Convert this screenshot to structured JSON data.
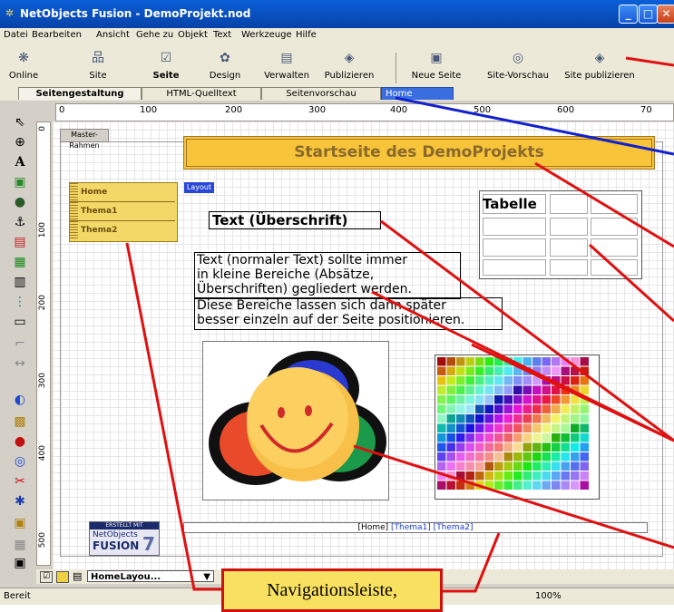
{
  "window": {
    "title": "NetObjects Fusion - DemoProjekt.nod",
    "app_icon": "netobjects-star-icon",
    "controls": [
      "minimize-icon",
      "maximize-icon",
      "close-icon"
    ]
  },
  "menu": [
    "Datei",
    "Bearbeiten",
    "Ansicht",
    "Gehe zu",
    "Objekt",
    "Text",
    "Werkzeuge",
    "Hilfe"
  ],
  "toolbar": [
    {
      "label": "Online",
      "icon": "online-icon"
    },
    {
      "label": "Site",
      "icon": "site-icon"
    },
    {
      "label": "Seite",
      "icon": "page-icon",
      "active": true
    },
    {
      "label": "Design",
      "icon": "design-icon"
    },
    {
      "label": "Verwalten",
      "icon": "manage-icon"
    },
    {
      "label": "Publizieren",
      "icon": "publish-icon"
    },
    {
      "label": "Neue Seite",
      "icon": "new-page-icon"
    },
    {
      "label": "Site-Vorschau",
      "icon": "site-preview-icon"
    },
    {
      "label": "Site publizieren",
      "icon": "site-publish-icon"
    }
  ],
  "tabs": [
    "Seitengestaltung",
    "HTML-Quelltext",
    "Seitenvorschau"
  ],
  "active_tab": "Seitengestaltung",
  "page_name": "Home",
  "ruler": {
    "h_labels": [
      "0",
      "100",
      "200",
      "300",
      "400",
      "500",
      "600",
      "70"
    ],
    "v_labels": [
      "0",
      "100",
      "200",
      "300",
      "400",
      "500"
    ]
  },
  "page": {
    "master_frame_label": "Master-Rahmen",
    "layout_label": "Layout",
    "banner_text": "Startseite des DemoProjekts",
    "nav_items": [
      "Home",
      "Thema1",
      "Thema2"
    ],
    "heading_text": "Text (Überschrift)",
    "body_lines_1": [
      "Text (normaler Text) sollte immer",
      "in kleine Bereiche (Absätze,",
      "Überschriften) gegliedert werden."
    ],
    "body_lines_2": [
      "Diese Bereiche lassen sich dann später",
      "besser einzeln auf der Seite positionieren."
    ],
    "table_header": "Tabelle",
    "footer_links": [
      "Home",
      "Thema1",
      "Thema2"
    ],
    "badge": {
      "line1": "ERSTELLT MIT",
      "line2": "NetObjects",
      "line3": "FUSION",
      "line4": "7"
    }
  },
  "bottom_toolbar": {
    "layout_select": "HomeLayou..."
  },
  "status": {
    "left": "Bereit",
    "zoom": "100%"
  },
  "callout": "Navigationsleiste,",
  "colors": {
    "banner": "#f7c43a",
    "nav": "#f2d866",
    "callout_border": "#d01010",
    "arrow_red": "#e01010",
    "arrow_blue": "#1020d0"
  }
}
